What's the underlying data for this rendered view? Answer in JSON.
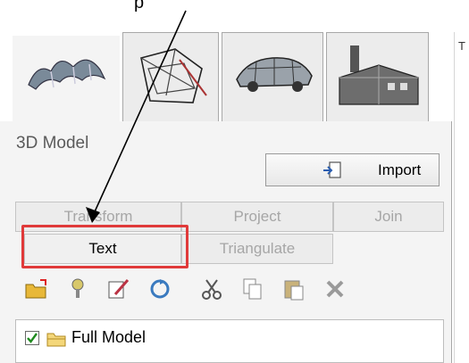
{
  "callout": {
    "text": "p"
  },
  "right_strip": {
    "letter": "T"
  },
  "icon_tabs": [
    {
      "name": "3d-model-icon"
    },
    {
      "name": "wireframe-icon"
    },
    {
      "name": "vehicle-icon"
    },
    {
      "name": "building-icon"
    }
  ],
  "panel": {
    "title": "3D Model",
    "import_label": "Import"
  },
  "tabs_row1": [
    "Transform",
    "Project",
    "Join"
  ],
  "tabs_row2": [
    "Text",
    "Triangulate"
  ],
  "toolbar_icons": [
    "open-folder-icon",
    "pin-icon",
    "edit-icon",
    "refresh-icon",
    "cut-icon",
    "copy-icon",
    "paste-icon",
    "delete-icon"
  ],
  "tree": {
    "item_label": "Full Model",
    "checked": true
  },
  "colors": {
    "highlight": "#e03a3a",
    "checkbox_check": "#1f8a1f"
  }
}
